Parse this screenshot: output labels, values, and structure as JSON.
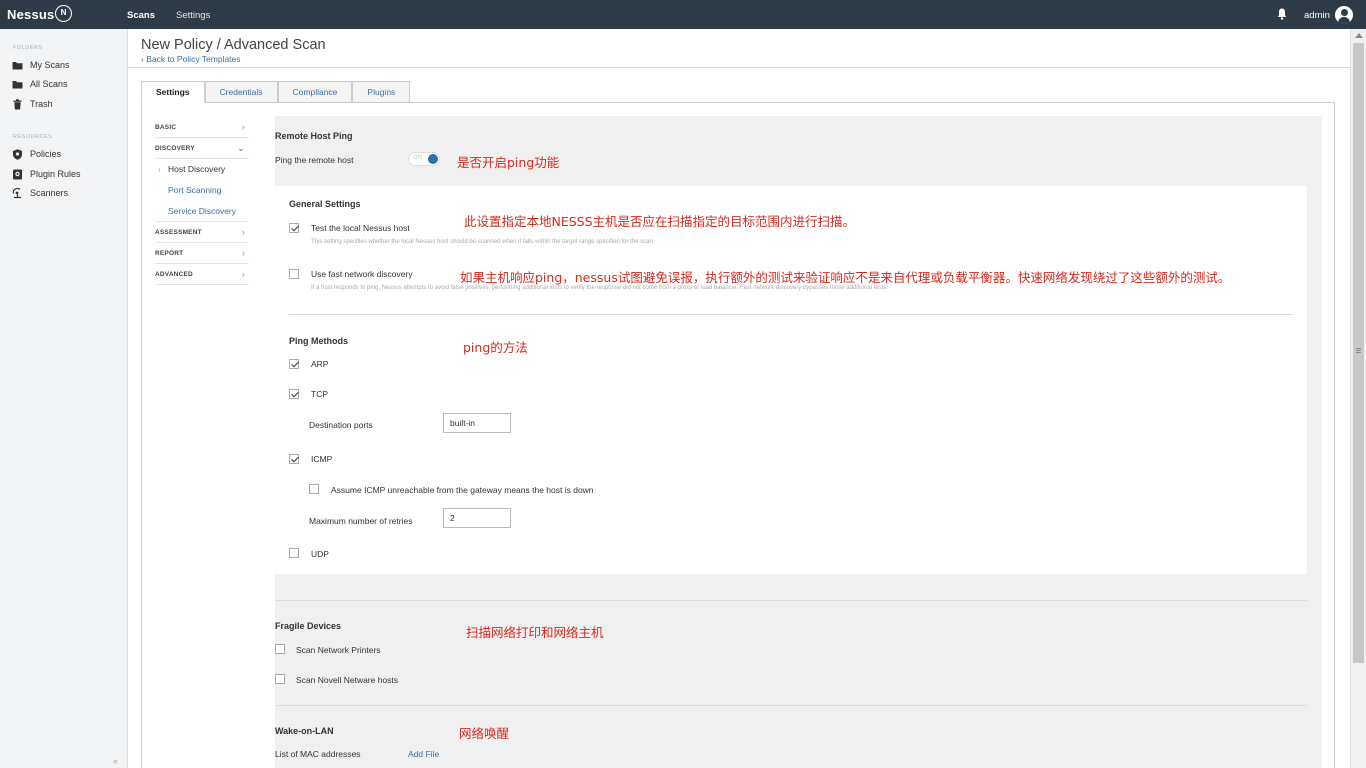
{
  "topbar": {
    "logo": "Nessus",
    "logo_badge": "N",
    "nav": [
      {
        "label": "Scans"
      },
      {
        "label": "Settings"
      }
    ],
    "user": "admin"
  },
  "sidebar": {
    "folders_heading": "FOLDERS",
    "folders": [
      {
        "label": "My Scans",
        "icon": "folder-icon"
      },
      {
        "label": "All Scans",
        "icon": "folder-icon"
      },
      {
        "label": "Trash",
        "icon": "trash-icon"
      }
    ],
    "resources_heading": "RESOURCES",
    "resources": [
      {
        "label": "Policies",
        "icon": "shield-icon"
      },
      {
        "label": "Plugin Rules",
        "icon": "plugin-rules-icon"
      },
      {
        "label": "Scanners",
        "icon": "scanner-icon"
      }
    ],
    "collapse": "«"
  },
  "page": {
    "title": "New Policy / Advanced Scan",
    "back_link": "‹ Back to Policy Templates"
  },
  "tabs": [
    {
      "label": "Settings",
      "active": true
    },
    {
      "label": "Credentials"
    },
    {
      "label": "Compliance"
    },
    {
      "label": "Plugins"
    }
  ],
  "settings_nav": {
    "basic": "BASIC",
    "discovery": "DISCOVERY",
    "discovery_items": [
      "Host Discovery",
      "Port Scanning",
      "Service Discovery"
    ],
    "assessment": "ASSESSMENT",
    "report": "REPORT",
    "advanced": "ADVANCED"
  },
  "remote_host_ping": {
    "title": "Remote Host Ping",
    "ping_label": "Ping the remote host",
    "ping_on": true,
    "toggle_text": "ON"
  },
  "general_settings": {
    "title": "General Settings",
    "test_local": {
      "label": "Test the local Nessus host",
      "checked": true,
      "hint": "This setting specifies whether the local Nessus host should be scanned when it falls within the target range specified for the scan."
    },
    "fast_discovery": {
      "label": "Use fast network discovery",
      "checked": false,
      "hint": "If a host responds to ping, Nessus attempts to avoid false positives, performing additional tests to verify the response did not come from a proxy or load balancer. Fast network discovery bypasses those additional tests."
    }
  },
  "ping_methods": {
    "title": "Ping Methods",
    "arp": {
      "label": "ARP",
      "checked": true
    },
    "tcp": {
      "label": "TCP",
      "checked": true
    },
    "dest_ports_label": "Destination ports",
    "dest_ports_value": "built-in",
    "icmp": {
      "label": "ICMP",
      "checked": true
    },
    "assume_unreachable": {
      "label": "Assume ICMP unreachable from the gateway means the host is down",
      "checked": false
    },
    "max_retries_label": "Maximum number of retries",
    "max_retries_value": "2",
    "udp": {
      "label": "UDP",
      "checked": false
    }
  },
  "fragile_devices": {
    "title": "Fragile Devices",
    "printers": {
      "label": "Scan Network Printers",
      "checked": false
    },
    "netware": {
      "label": "Scan Novell Netware hosts",
      "checked": false
    }
  },
  "wake_on_lan": {
    "title": "Wake-on-LAN",
    "mac_label": "List of MAC addresses",
    "add_file": "Add File"
  },
  "annotations": {
    "ping_toggle": "是否开启ping功能",
    "test_local": "此设置指定本地NESSS主机是否应在扫描指定的目标范围内进行扫描。",
    "fast_discovery": "如果主机响应ping，nessus试图避免误报，执行额外的测试来验证响应不是来自代理或负载平衡器。快速网络发现绕过了这些额外的测试。",
    "ping_methods": "ping的方法",
    "fragile": "扫描网络打印和网络主机",
    "wol": "网络唤醒"
  },
  "colors": {
    "topbar": "#2e3b46",
    "link": "#3b6fa6",
    "toggle_on": "#2b6eb5",
    "annotation": "#d42a1e"
  }
}
